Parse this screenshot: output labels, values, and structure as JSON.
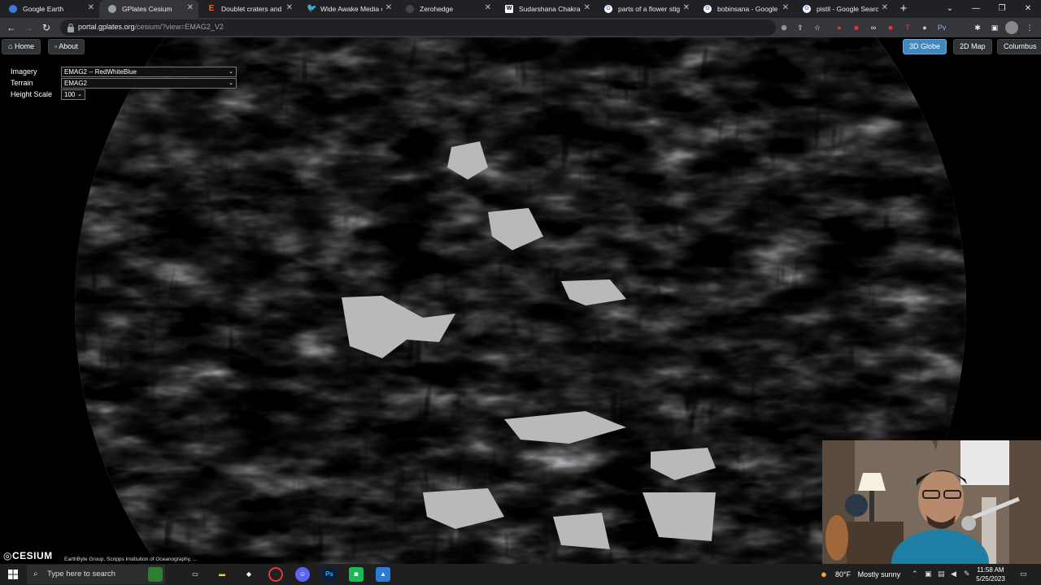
{
  "tabs": [
    {
      "title": "Google Earth",
      "favicon": "google-earth-icon",
      "color": "#3c78d8",
      "active": false
    },
    {
      "title": "GPlates Cesium",
      "favicon": "globe-icon",
      "color": "#9aa0a6",
      "active": true
    },
    {
      "title": "Doublet craters and th",
      "favicon": "etsy-e-icon",
      "color": "#f1641e",
      "active": false
    },
    {
      "title": "Wide Awake Media or",
      "favicon": "twitter-bird-icon",
      "color": "#1d9bf0",
      "active": false
    },
    {
      "title": "Zerohedge",
      "favicon": "zerohedge-icon",
      "color": "#444444",
      "active": false
    },
    {
      "title": "Sudarshana Chakra -",
      "favicon": "wikipedia-w-icon",
      "color": "#ffffff",
      "active": false
    },
    {
      "title": "parts of a flower stigm",
      "favicon": "google-g-icon",
      "color": "#ffffff",
      "active": false
    },
    {
      "title": "bobinsana - Google S",
      "favicon": "google-g-icon",
      "color": "#ffffff",
      "active": false
    },
    {
      "title": "pistil - Google Search",
      "favicon": "google-g-icon",
      "color": "#ffffff",
      "active": false
    }
  ],
  "address": {
    "domain": "portal.gplates.org",
    "path": "/cesium/?view=EMAG2_V2"
  },
  "map_toolbar": {
    "home": "Home",
    "about": "About"
  },
  "view_modes": [
    "3D Globe",
    "2D Map",
    "Columbus"
  ],
  "active_view": "3D Globe",
  "controls": {
    "imagery_label": "Imagery",
    "imagery_value": "EMAG2 -- RedWhiteBlue",
    "terrain_label": "Terrain",
    "terrain_value": "EMAG2",
    "height_label": "Height Scale",
    "height_value": "100"
  },
  "cesium_logo": "CESIUM",
  "credits": "EarthByte Group, Scripps Institution of Oceanography, ...",
  "taskbar": {
    "search_placeholder": "Type here to search"
  },
  "weather": {
    "temp": "80°F",
    "condition": "Mostly sunny"
  },
  "clock": {
    "time": "11:58 AM",
    "date": "5/25/2023"
  },
  "colors": {
    "accent": "#4488bb",
    "chrome_dark": "#202124",
    "chrome_tab": "#35363a"
  }
}
